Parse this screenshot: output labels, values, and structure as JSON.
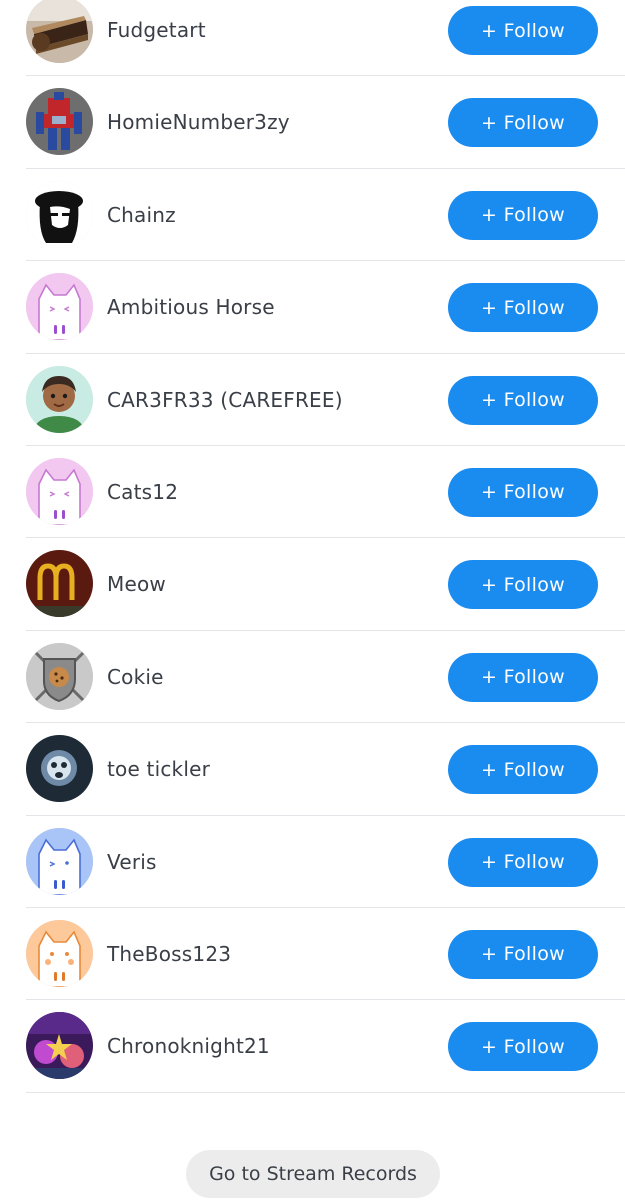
{
  "follow_label": "+ Follow",
  "users": [
    {
      "name": "Fudgetart",
      "avatar_icon": "cake-photo-avatar"
    },
    {
      "name": "HomieNumber3zy",
      "avatar_icon": "robot-toy-avatar"
    },
    {
      "name": "Chainz",
      "avatar_icon": "sketch-portrait-avatar"
    },
    {
      "name": "Ambitious Horse",
      "avatar_icon": "default-cat-pink-avatar"
    },
    {
      "name": "CAR3FR33 (CAREFREE)",
      "avatar_icon": "drawn-character-avatar"
    },
    {
      "name": "Cats12",
      "avatar_icon": "default-cat-pink-avatar"
    },
    {
      "name": "Meow",
      "avatar_icon": "golden-arches-avatar"
    },
    {
      "name": "Cokie",
      "avatar_icon": "cookie-shield-avatar"
    },
    {
      "name": "toe tickler",
      "avatar_icon": "glowing-face-avatar"
    },
    {
      "name": "Veris",
      "avatar_icon": "default-cat-blue-avatar"
    },
    {
      "name": "TheBoss123",
      "avatar_icon": "default-cat-orange-avatar"
    },
    {
      "name": "Chronoknight21",
      "avatar_icon": "game-art-avatar"
    }
  ],
  "stream_records_label": "Go to Stream Records",
  "colors": {
    "follow_button": "#1a8cf0",
    "divider": "#e3e5e8",
    "text": "#3a3f47",
    "secondary_button": "#ececed"
  }
}
